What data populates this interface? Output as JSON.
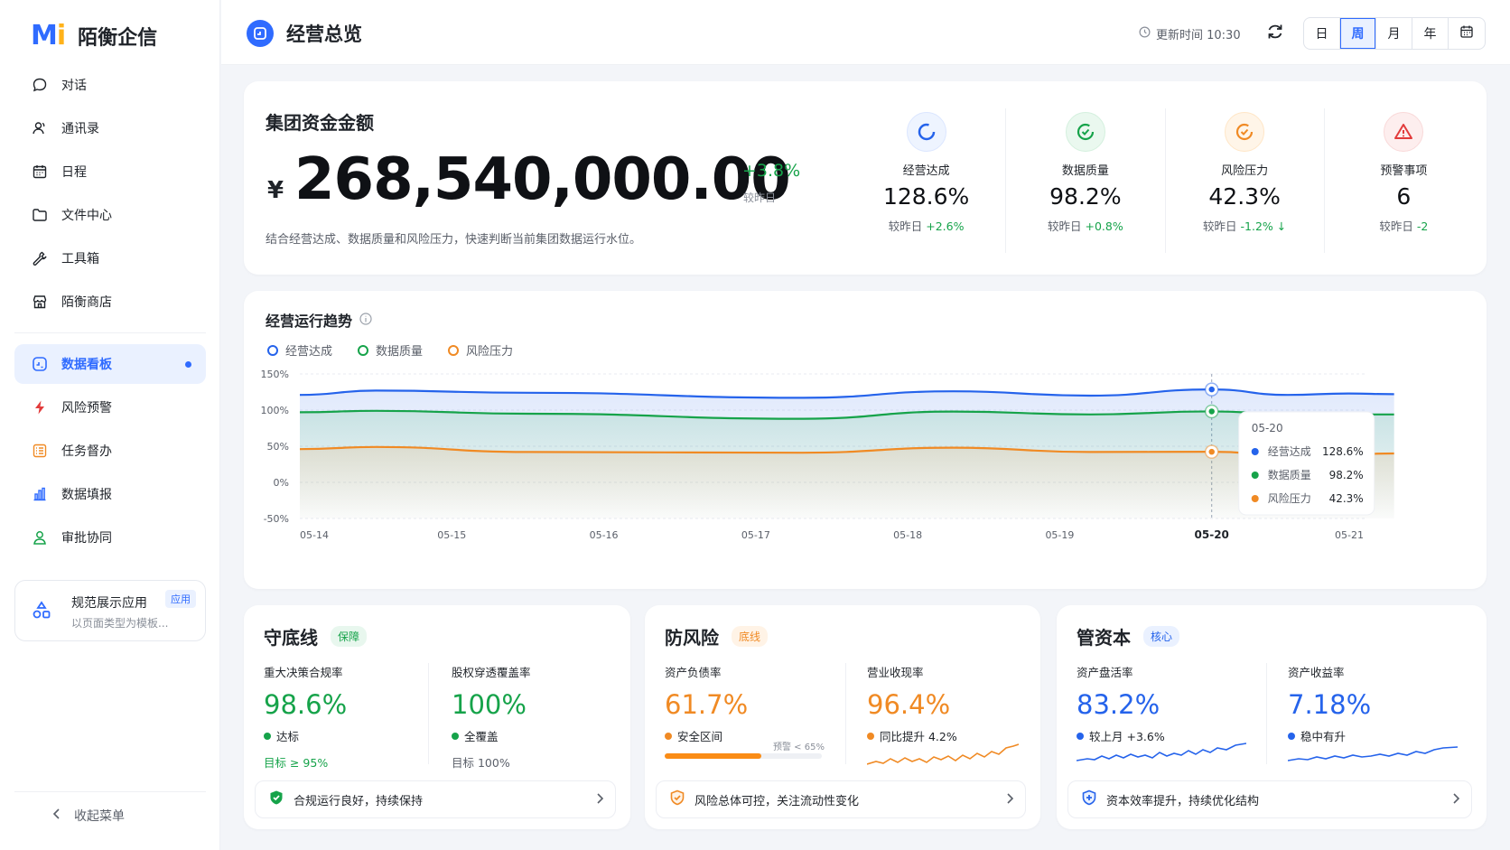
{
  "brand": {
    "logo_a": "M",
    "logo_b": "i",
    "name": "陌衡企信"
  },
  "sidebar": {
    "items": [
      {
        "label": "对话",
        "icon": "chat-icon"
      },
      {
        "label": "通讯录",
        "icon": "contacts-icon"
      },
      {
        "label": "日程",
        "icon": "calendar-icon"
      },
      {
        "label": "文件中心",
        "icon": "folder-icon"
      },
      {
        "label": "工具箱",
        "icon": "wrench-icon"
      },
      {
        "label": "陌衡商店",
        "icon": "store-icon"
      },
      {
        "label": "数据看板",
        "icon": "dashboard-icon",
        "active": true
      },
      {
        "label": "风险预警",
        "icon": "lightning-icon"
      },
      {
        "label": "任务督办",
        "icon": "tasks-icon"
      },
      {
        "label": "数据填报",
        "icon": "bar-chart-icon"
      },
      {
        "label": "审批协同",
        "icon": "user-icon"
      }
    ],
    "app_card": {
      "title": "规范展示应用",
      "subtitle": "以页面类型为模板...",
      "tag": "应用"
    },
    "collapse_label": "收起菜单"
  },
  "header": {
    "title": "经营总览",
    "update_time": "更新时间 10:30",
    "periods": [
      "日",
      "周",
      "月",
      "年"
    ],
    "active_period": "周"
  },
  "summary": {
    "title": "集团资金金额",
    "currency": "¥",
    "amount": "268,540,000.00",
    "change": "+3.8%",
    "change_label": "较昨日",
    "description": "结合经营达成、数据质量和风险压力，快速判断当前集团数据运行水位。",
    "kpis": [
      {
        "label": "经营达成",
        "value": "128.6%",
        "delta_prefix": "较昨日",
        "delta": "+2.6%",
        "color": "#16a34a"
      },
      {
        "label": "数据质量",
        "value": "98.2%",
        "delta_prefix": "较昨日",
        "delta": "+0.8%",
        "color": "#16a34a"
      },
      {
        "label": "风险压力",
        "value": "42.3%",
        "delta_prefix": "较昨日",
        "delta": "-1.2% ↓",
        "color": "#16a34a"
      },
      {
        "label": "预警事项",
        "value": "6",
        "delta_prefix": "较昨日",
        "delta": "-2",
        "color": "#16a34a"
      }
    ]
  },
  "trend": {
    "title": "经营运行趋势",
    "tooltip": {
      "date": "05-20",
      "rows": [
        {
          "label": "经营达成",
          "value": "128.6%"
        },
        {
          "label": "数据质量",
          "value": "98.2%"
        },
        {
          "label": "风险压力",
          "value": "42.3%"
        }
      ]
    }
  },
  "chart_data": {
    "type": "line",
    "x": [
      "05-14",
      "05-15",
      "05-16",
      "05-17",
      "05-18",
      "05-19",
      "05-20",
      "05-21"
    ],
    "highlight_x": "05-20",
    "ylim": [
      -50,
      150
    ],
    "yticks": [
      "150%",
      "100%",
      "50%",
      "0%",
      "-50%"
    ],
    "grid": true,
    "legend": "top-left",
    "series": [
      {
        "name": "经营达成",
        "color": "#2563eb",
        "values": [
          121,
          127,
          124,
          117,
          126,
          120,
          128.6,
          121,
          123,
          122
        ]
      },
      {
        "name": "数据质量",
        "color": "#16a34a",
        "values": [
          97,
          99,
          95,
          88,
          98,
          94,
          98.2,
          95,
          94,
          94
        ]
      },
      {
        "name": "风险压力",
        "color": "#f08a24",
        "values": [
          46,
          49,
          42,
          41,
          48,
          42,
          42.3,
          38,
          39,
          40
        ]
      }
    ],
    "values_x": [
      0,
      0.5,
      1.5,
      3.3,
      4.3,
      5.2,
      6,
      6.5,
      6.9,
      7.2
    ]
  },
  "bottom": [
    {
      "title": "守底线",
      "badge": "保障",
      "badge_color": "#16a34a",
      "badge_bg": "#e8f7ee",
      "metrics": [
        {
          "label": "重大决策合规率",
          "value": "98.6%",
          "status": "达标",
          "target": "目标 ≥ 95%",
          "color": "#16a34a",
          "target_color": "#16a34a"
        },
        {
          "label": "股权穿透覆盖率",
          "value": "100%",
          "status": "全覆盖",
          "target": "目标 100%",
          "color": "#16a34a",
          "target_color": "#5a5f69"
        }
      ],
      "footer": "合规运行良好，持续保持"
    },
    {
      "title": "防风险",
      "badge": "底线",
      "badge_color": "#f08a24",
      "badge_bg": "#fff3e6",
      "metrics": [
        {
          "label": "资产负债率",
          "value": "61.7%",
          "status": "安全区间",
          "color": "#f08a24",
          "bar_label": "预警 < 65%",
          "bar": 0.617
        },
        {
          "label": "营业收现率",
          "value": "96.4%",
          "status": "同比提升 4.2%",
          "color": "#f08a24"
        }
      ],
      "footer": "风险总体可控，关注流动性变化"
    },
    {
      "title": "管资本",
      "badge": "核心",
      "badge_color": "#2563eb",
      "badge_bg": "#eaf1ff",
      "metrics": [
        {
          "label": "资产盘活率",
          "value": "83.2%",
          "status": "较上月 +3.6%",
          "color": "#2563eb"
        },
        {
          "label": "资产收益率",
          "value": "7.18%",
          "status": "稳中有升",
          "color": "#2563eb"
        }
      ],
      "footer": "资本效率提升，持续优化结构"
    }
  ]
}
